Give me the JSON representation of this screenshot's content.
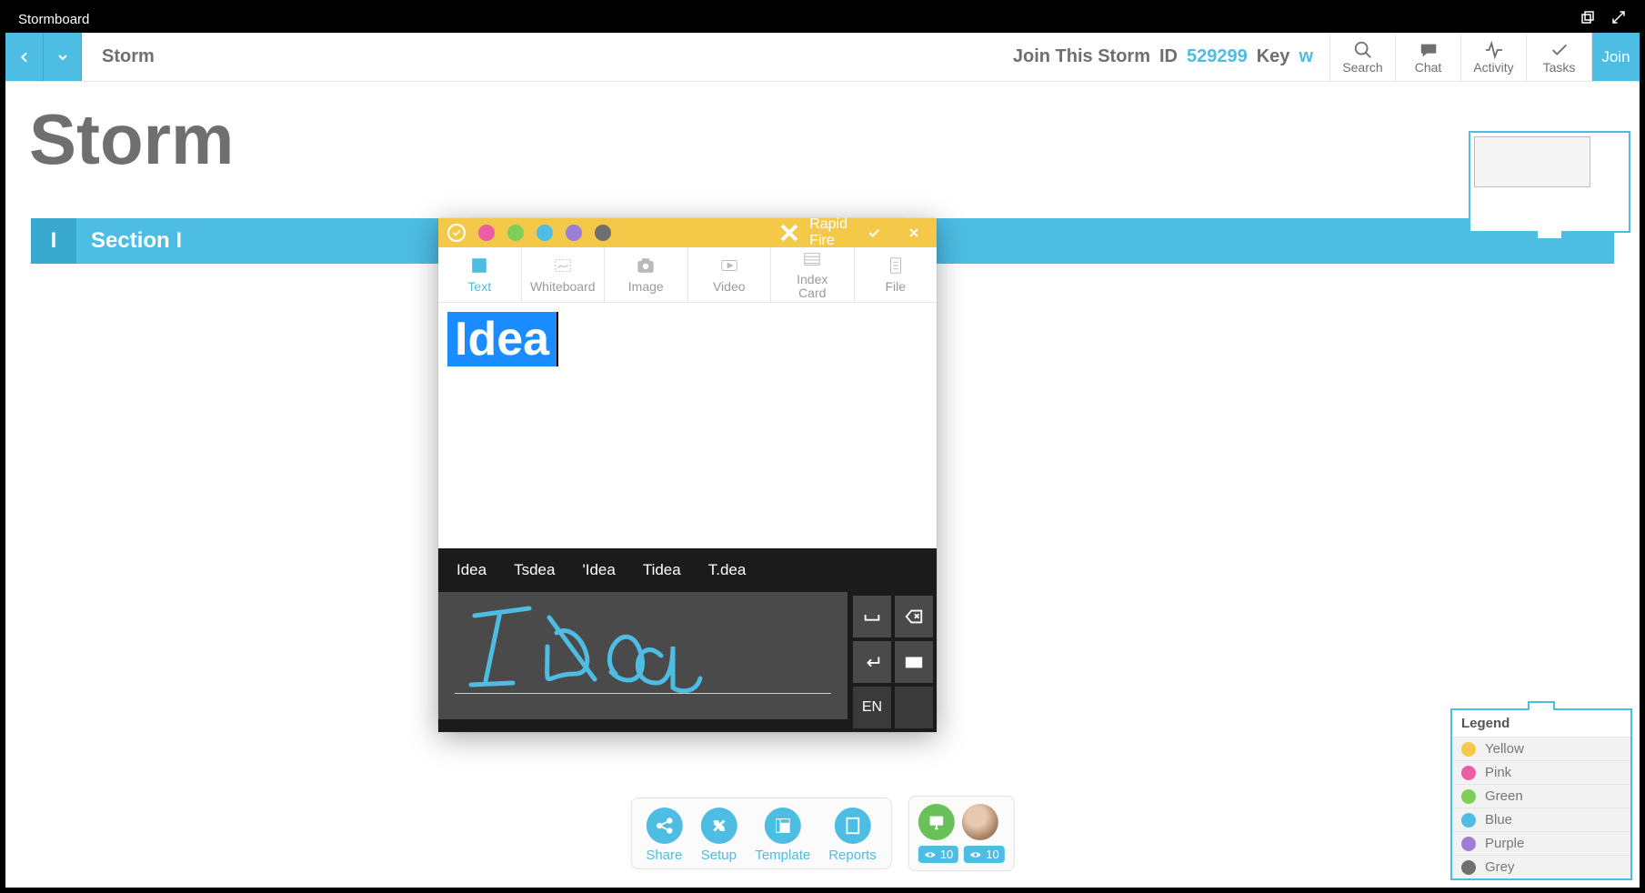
{
  "window": {
    "app_title": "Stormboard"
  },
  "toolbar": {
    "storm_name": "Storm",
    "join_prefix": "Join This Storm",
    "id_label": "ID",
    "id_value": "529299",
    "key_label": "Key",
    "key_value": "w",
    "tools": {
      "search": "Search",
      "chat": "Chat",
      "activity": "Activity",
      "tasks": "Tasks"
    },
    "join_btn": "Join"
  },
  "canvas": {
    "title": "Storm",
    "section_number": "I",
    "section_label": "Section I"
  },
  "bottom": {
    "share": "Share",
    "setup": "Setup",
    "template": "Template",
    "reports": "Reports",
    "badge1": "10",
    "badge2": "10"
  },
  "legend": {
    "title": "Legend",
    "items": [
      {
        "label": "Yellow",
        "color": "#f4c94a"
      },
      {
        "label": "Pink",
        "color": "#ec5ea4"
      },
      {
        "label": "Green",
        "color": "#7ece58"
      },
      {
        "label": "Blue",
        "color": "#4dbde4"
      },
      {
        "label": "Purple",
        "color": "#9b7fd4"
      },
      {
        "label": "Grey",
        "color": "#6f6f6f"
      }
    ]
  },
  "modal": {
    "rapid_fire": "Rapid Fire",
    "colors": [
      "#ec5ea4",
      "#7ece58",
      "#4dbde4",
      "#9b7fd4",
      "#6f6f6f"
    ],
    "tabs": {
      "text": "Text",
      "whiteboard": "Whiteboard",
      "image": "Image",
      "video": "Video",
      "index_card": "Index\nCard",
      "file": "File"
    },
    "entered_text": "Idea"
  },
  "handwriting": {
    "suggestions": [
      "Idea",
      "Tsdea",
      "'Idea",
      "Tidea",
      "T.dea"
    ],
    "language": "EN"
  }
}
